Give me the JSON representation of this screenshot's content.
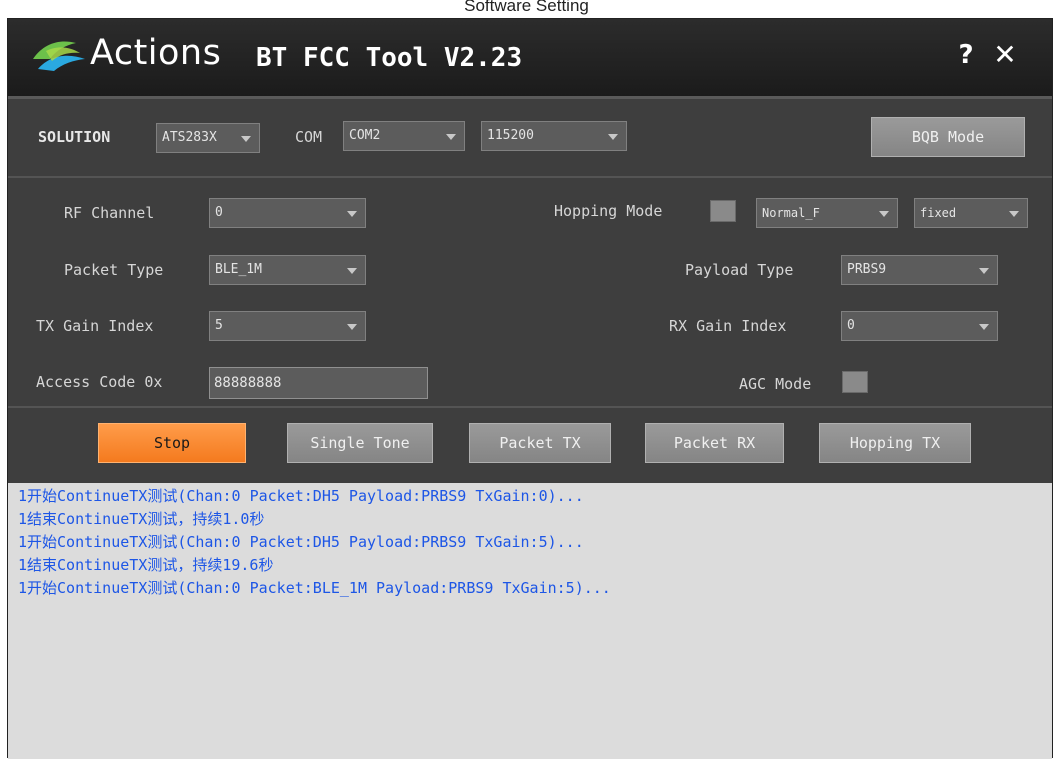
{
  "caption": "Software Setting",
  "window": {
    "brand": "Actions",
    "title": "BT FCC Tool V2.23",
    "help_label": "?",
    "close_label": "✕"
  },
  "top_bar": {
    "solution_label": "SOLUTION",
    "solution_value": "ATS283X",
    "com_label": "COM",
    "com_value": "COM2",
    "baud_value": "115200",
    "bqb_button": "BQB Mode"
  },
  "settings": {
    "rf_channel_label": "RF Channel",
    "rf_channel_value": "0",
    "packet_type_label": "Packet Type",
    "packet_type_value": "BLE_1M",
    "tx_gain_label": "TX Gain Index",
    "tx_gain_value": "5",
    "access_code_label": "Access Code 0x",
    "access_code_value": "88888888",
    "hopping_mode_label": "Hopping Mode",
    "hopping_mode_value": "Normal_F",
    "hopping_fixed_value": "fixed",
    "payload_type_label": "Payload Type",
    "payload_type_value": "PRBS9",
    "rx_gain_label": "RX Gain Index",
    "rx_gain_value": "0",
    "agc_mode_label": "AGC Mode"
  },
  "actions": {
    "stop": "Stop",
    "single_tone": "Single Tone",
    "packet_tx": "Packet TX",
    "packet_rx": "Packet RX",
    "hopping_tx": "Hopping TX"
  },
  "log": [
    "1开始ContinueTX测试(Chan:0 Packet:DH5 Payload:PRBS9 TxGain:0)...",
    "1结束ContinueTX测试，持续1.0秒",
    "1开始ContinueTX测试(Chan:0 Packet:DH5 Payload:PRBS9 TxGain:5)...",
    "1结束ContinueTX测试，持续19.6秒",
    "1开始ContinueTX测试(Chan:0 Packet:BLE_1M Payload:PRBS9 TxGain:5)..."
  ],
  "colors": {
    "log_text": "#1d56e6",
    "stop_button": "#f47a1e",
    "window_bg": "#3e3e3e"
  }
}
